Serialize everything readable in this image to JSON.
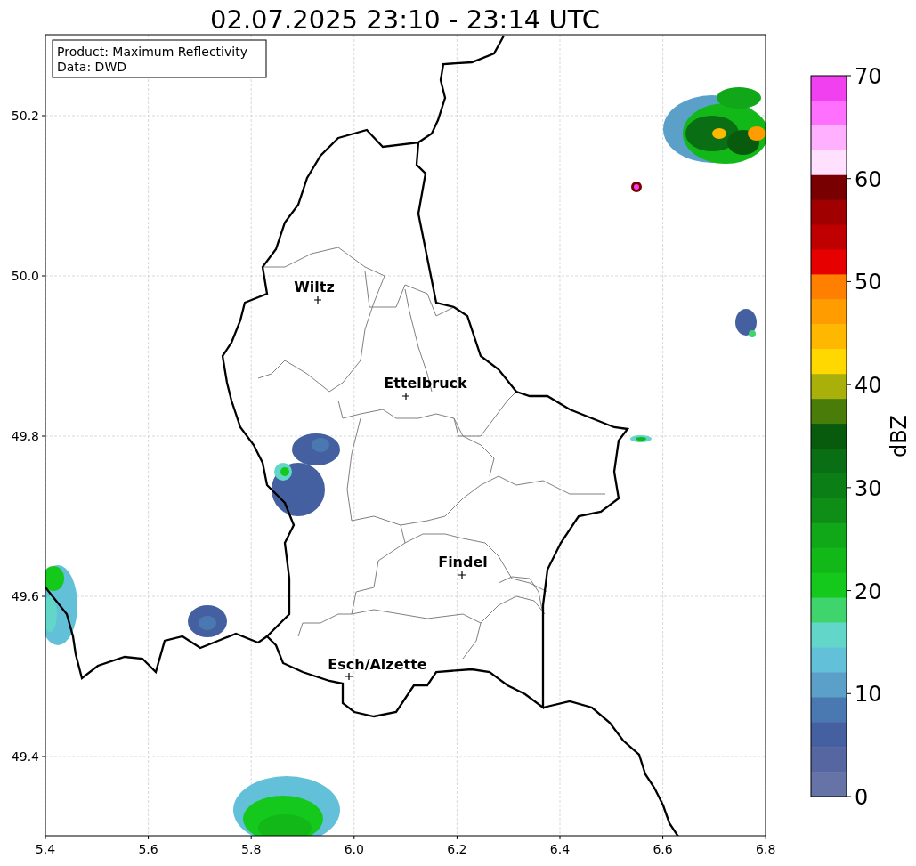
{
  "title": "02.07.2025 23:10 - 23:14 UTC",
  "info_box": [
    "Product: Maximum Reflectivity",
    "Data: DWD"
  ],
  "map": {
    "x_ticks": [
      "5.4",
      "5.6",
      "5.8",
      "6.0",
      "6.2",
      "6.4",
      "6.6",
      "6.8"
    ],
    "y_ticks": [
      "50.2",
      "50.0",
      "49.8",
      "49.6",
      "49.4"
    ],
    "cities": [
      {
        "name": "Wiltz"
      },
      {
        "name": "Ettelbruck"
      },
      {
        "name": "Findel"
      },
      {
        "name": "Esch/Alzette"
      }
    ]
  },
  "colorbar": {
    "label": "dBZ",
    "ticks": [
      "70",
      "60",
      "50",
      "40",
      "30",
      "20",
      "10",
      "0"
    ],
    "bins": [
      {
        "color": "#f040f0"
      },
      {
        "color": "#ff70ff"
      },
      {
        "color": "#ffb0ff"
      },
      {
        "color": "#ffe0ff"
      },
      {
        "color": "#780000"
      },
      {
        "color": "#a00000"
      },
      {
        "color": "#c00000"
      },
      {
        "color": "#e60000"
      },
      {
        "color": "#ff8000"
      },
      {
        "color": "#ff9c00"
      },
      {
        "color": "#ffb800"
      },
      {
        "color": "#ffd800"
      },
      {
        "color": "#aab00a"
      },
      {
        "color": "#4a7c0a"
      },
      {
        "color": "#085a0c"
      },
      {
        "color": "#0a6e14"
      },
      {
        "color": "#0c7e16"
      },
      {
        "color": "#0e8e16"
      },
      {
        "color": "#10a818"
      },
      {
        "color": "#12b818"
      },
      {
        "color": "#14c81c"
      },
      {
        "color": "#40d46c"
      },
      {
        "color": "#62d6c8"
      },
      {
        "color": "#62c0d8"
      },
      {
        "color": "#5aa0c8"
      },
      {
        "color": "#4a78b0"
      },
      {
        "color": "#4560a0"
      },
      {
        "color": "#5566a0"
      },
      {
        "color": "#6573a6"
      }
    ]
  }
}
